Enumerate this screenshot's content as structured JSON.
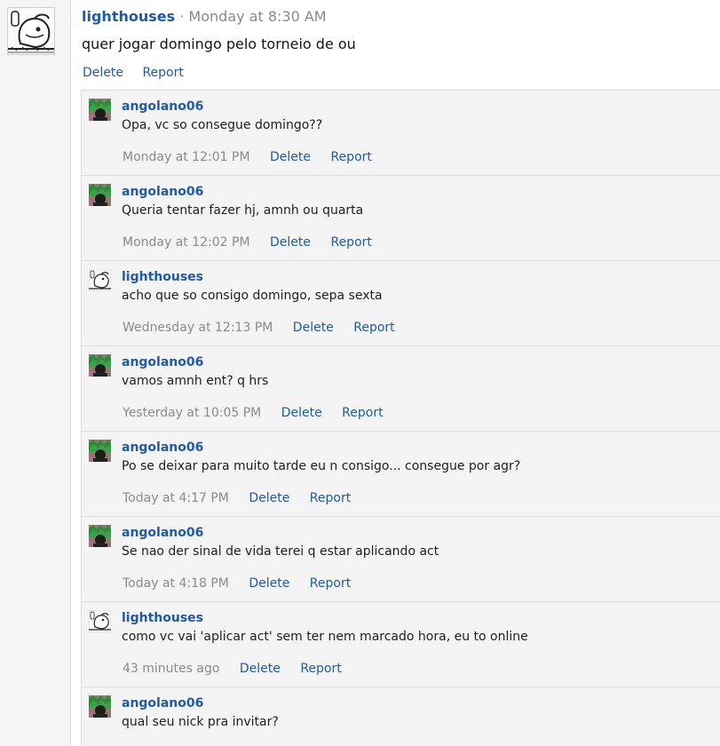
{
  "post": {
    "author": "lighthouses",
    "separator": "·",
    "timestamp": "Monday at 8:30 AM",
    "message": "quer jogar domingo pelo torneio de ou",
    "delete_label": "Delete",
    "report_label": "Report"
  },
  "comments": [
    {
      "author": "angolano06",
      "text": "Opa, vc so consegue domingo??",
      "time": "Monday at 12:01 PM",
      "delete_label": "Delete",
      "report_label": "Report",
      "avatar": "green-avatar"
    },
    {
      "author": "angolano06",
      "text": "Queria tentar fazer hj, amnh ou quarta",
      "time": "Monday at 12:02 PM",
      "delete_label": "Delete",
      "report_label": "Report",
      "avatar": "green-avatar"
    },
    {
      "author": "lighthouses",
      "text": "acho que so consigo domingo, sepa sexta",
      "time": "Wednesday at 12:13 PM",
      "delete_label": "Delete",
      "report_label": "Report",
      "avatar": "manga-avatar"
    },
    {
      "author": "angolano06",
      "text": "vamos amnh ent? q hrs",
      "time": "Yesterday at 10:05 PM",
      "delete_label": "Delete",
      "report_label": "Report",
      "avatar": "green-avatar"
    },
    {
      "author": "angolano06",
      "text": "Po se deixar para muito tarde eu n consigo... consegue por agr?",
      "time": "Today at 4:17 PM",
      "delete_label": "Delete",
      "report_label": "Report",
      "avatar": "green-avatar"
    },
    {
      "author": "angolano06",
      "text": "Se nao der sinal de vida terei q estar aplicando act",
      "time": "Today at 4:18 PM",
      "delete_label": "Delete",
      "report_label": "Report",
      "avatar": "green-avatar"
    },
    {
      "author": "lighthouses",
      "text": "como vc vai 'aplicar act' sem ter nem marcado hora, eu to online",
      "time": "43 minutes ago",
      "delete_label": "Delete",
      "report_label": "Report",
      "avatar": "manga-avatar"
    },
    {
      "author": "angolano06",
      "text": "qual seu nick pra invitar?",
      "time": "",
      "delete_label": "",
      "report_label": "",
      "avatar": "green-avatar"
    }
  ],
  "colors": {
    "link": "#1f5aa6",
    "muted": "#8a8a8a",
    "comment_bg": "#f4f4f4",
    "rail_bg": "#f5f5f5"
  }
}
